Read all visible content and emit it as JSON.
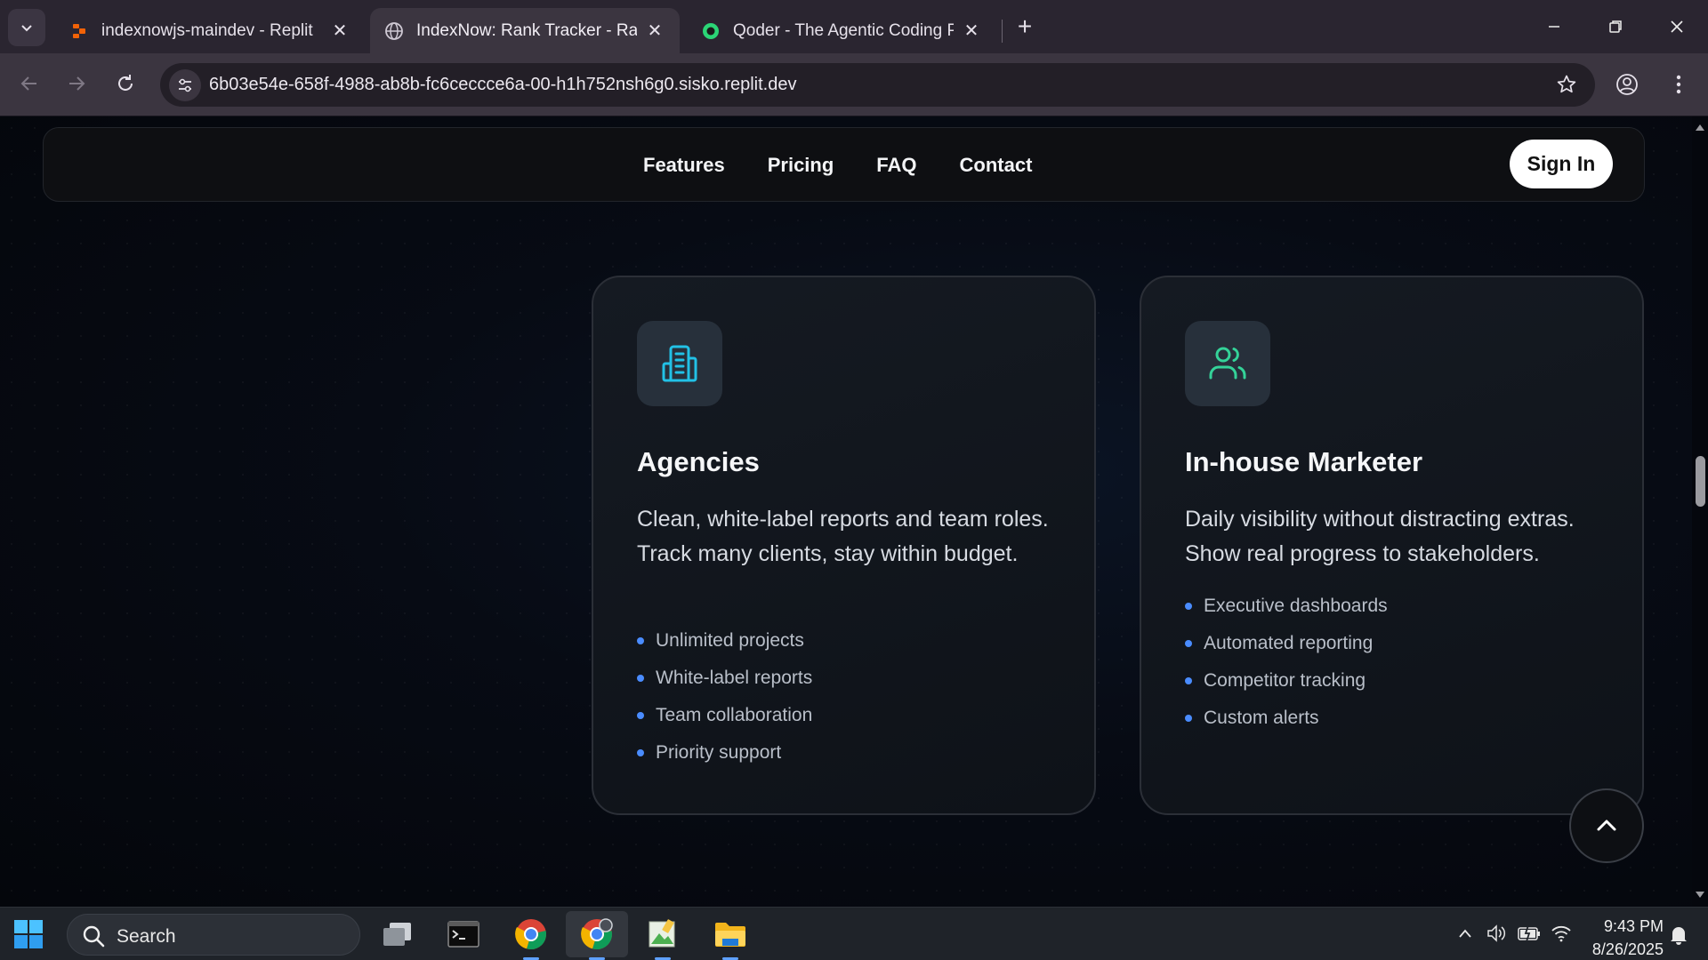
{
  "browser": {
    "tabs": [
      {
        "title": "indexnowjs-maindev - Replit",
        "active": false
      },
      {
        "title": "IndexNow: Rank Tracker - Rank",
        "active": true
      },
      {
        "title": "Qoder - The Agentic Coding Pla",
        "active": false
      }
    ],
    "url": "6b03e54e-658f-4988-ab8b-fc6ceccce6a-00-h1h752nsh6g0.sisko.replit.dev"
  },
  "site_nav": {
    "links": [
      "Features",
      "Pricing",
      "FAQ",
      "Contact"
    ],
    "signin_label": "Sign In"
  },
  "cards": [
    {
      "icon": "building-icon",
      "icon_color": "#22c1e6",
      "title": "Agencies",
      "description": "Clean, white-label reports and team roles. Track many clients, stay within budget.",
      "features": [
        "Unlimited projects",
        "White-label reports",
        "Team collaboration",
        "Priority support"
      ]
    },
    {
      "icon": "users-icon",
      "icon_color": "#34d399",
      "title": "In-house Marketer",
      "description": "Daily visibility without distracting extras. Show real progress to stakeholders.",
      "features": [
        "Executive dashboards",
        "Automated reporting",
        "Competitor tracking",
        "Custom alerts"
      ]
    }
  ],
  "taskbar": {
    "search_placeholder": "Search",
    "time": "9:43 PM",
    "date": "8/26/2025"
  },
  "colors": {
    "bullet": "#4a8cff",
    "accent_cyan": "#22c1e6",
    "accent_green": "#34d399"
  }
}
